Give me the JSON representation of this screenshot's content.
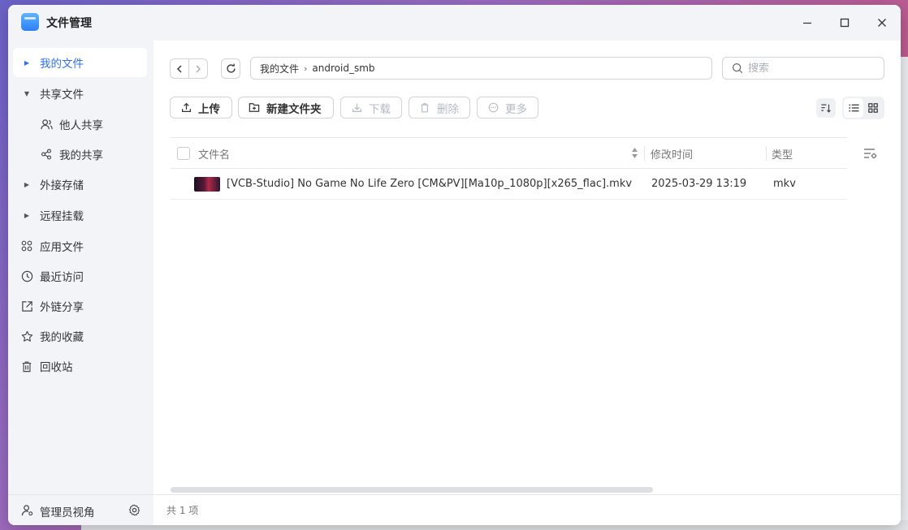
{
  "window": {
    "title": "文件管理"
  },
  "sidebar": {
    "items": [
      {
        "label": "我的文件"
      },
      {
        "label": "共享文件"
      },
      {
        "label": "他人共享"
      },
      {
        "label": "我的共享"
      },
      {
        "label": "外接存储"
      },
      {
        "label": "远程挂载"
      },
      {
        "label": "应用文件"
      },
      {
        "label": "最近访问"
      },
      {
        "label": "外链分享"
      },
      {
        "label": "我的收藏"
      },
      {
        "label": "回收站"
      }
    ],
    "footer_label": "管理员视角"
  },
  "breadcrumb": {
    "root": "我的文件",
    "current": "android_smb"
  },
  "search": {
    "placeholder": "搜索"
  },
  "toolbar": {
    "upload": "上传",
    "new_folder": "新建文件夹",
    "download": "下载",
    "delete": "删除",
    "more": "更多"
  },
  "table": {
    "columns": [
      "文件名",
      "修改时间",
      "类型"
    ],
    "rows": [
      {
        "name": "[VCB-Studio] No Game No Life Zero [CM&PV][Ma10p_1080p][x265_flac].mkv",
        "modified": "2025-03-29 13:19",
        "type": "mkv"
      }
    ]
  },
  "status": {
    "count_text": "共 1 项"
  },
  "colors": {
    "accent": "#2f6ff0",
    "sidebar_bg": "#f2f4f8"
  }
}
